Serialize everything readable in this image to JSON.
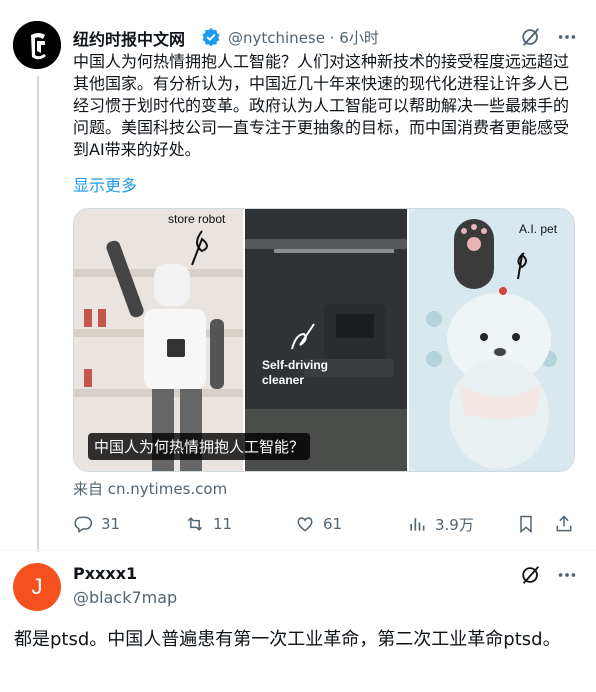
{
  "tweet": {
    "author_name": "纽约时报中文网",
    "handle": "@nytchinese · 6小时",
    "text": "中国人为何热情拥抱人工智能？人们对这种新技术的接受程度远远超过其他国家。有分析认为，中国近几十年来快速的现代化进程让许多人已经习惯于划时代的变革。政府认为人工智能可以帮助解决一些最棘手的问题。美国科技公司一直专注于更抽象的目标，而中国消费者更能感受到AI带来的好处。",
    "show_more": "显示更多",
    "media": {
      "label_robot": "store robot",
      "label_cleaner_1": "Self-driving",
      "label_cleaner_2": "cleaner",
      "label_pet": "A.I. pet",
      "caption": "中国人为何热情拥抱人工智能？"
    },
    "source": "来自 cn.nytimes.com",
    "actions": {
      "replies": "31",
      "reposts": "11",
      "likes": "61",
      "views": "3.9万"
    }
  },
  "reply": {
    "avatar_letter": "J",
    "author_name": "Pxxxx1",
    "handle": "@black7map",
    "text": "都是ptsd。中国人普遍患有第一次工业革命，第二次工业革命ptsd。"
  },
  "colors": {
    "accent": "#1d9bf0",
    "muted": "#536471",
    "avatar_reply": "#f4511e"
  },
  "icons": [
    "grok-icon",
    "more-icon",
    "verified-icon",
    "reply-icon",
    "repost-icon",
    "like-icon",
    "views-icon",
    "bookmark-icon",
    "share-icon"
  ]
}
